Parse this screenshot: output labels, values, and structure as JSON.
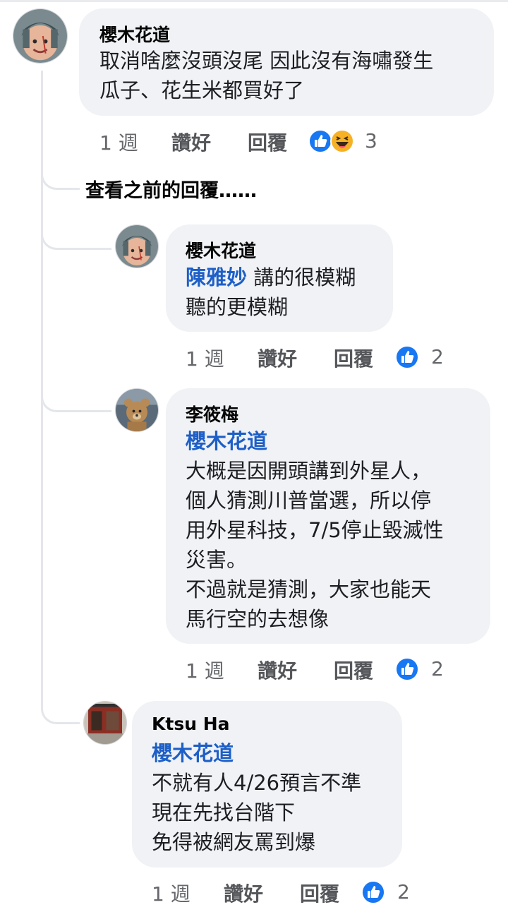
{
  "comments": [
    {
      "author": "櫻木花道",
      "text_lines": [
        "取消啥麼沒頭沒尾  因此沒有海嘯發生",
        "瓜子、花生米都買好了"
      ],
      "time": "1 週",
      "like_label": "讚好",
      "reply_label": "回覆",
      "reaction_count": "3",
      "reactions": [
        "like-icon",
        "haha-icon"
      ]
    },
    {
      "author": "櫻木花道",
      "mention": "陳雅妙",
      "first_line_rest": " 講的很模糊",
      "text_lines": [
        "聽的更模糊"
      ],
      "time": "1 週",
      "like_label": "讚好",
      "reply_label": "回覆",
      "reaction_count": "2",
      "reactions": [
        "like-icon"
      ]
    },
    {
      "author": "李筱梅",
      "mention": "櫻木花道",
      "text_lines": [
        "大概是因開頭講到外星人，",
        "個人猜測川普當選，所以停",
        "用外星科技，7/5停止毀滅性",
        "災害。",
        "不過就是猜測，大家也能天",
        "馬行空的去想像"
      ],
      "time": "1 週",
      "like_label": "讚好",
      "reply_label": "回覆",
      "reaction_count": "2",
      "reactions": [
        "like-icon"
      ]
    },
    {
      "author": "Ktsu Ha",
      "mention": "櫻木花道",
      "text_lines": [
        "不就有人4/26預言不準",
        "現在先找台階下",
        "免得被網友罵到爆"
      ],
      "time": "1 週",
      "like_label": "讚好",
      "reply_label": "回覆",
      "reaction_count": "2",
      "reactions": [
        "like-icon"
      ]
    }
  ],
  "view_previous_replies": "查看之前的回覆……",
  "colors": {
    "bubble": "#f0f2f5",
    "mention": "#1d5fc7",
    "like_blue": "#1877f2",
    "haha_yellow": "#f7b125",
    "thread_line": "#e4e6eb"
  }
}
